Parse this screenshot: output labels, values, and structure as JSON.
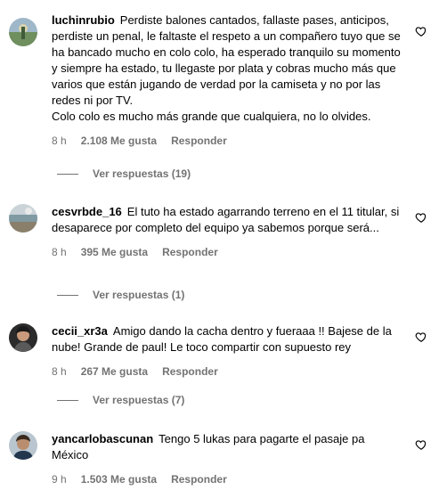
{
  "comments": [
    {
      "username": "luchinrubio",
      "text": "Perdiste balones cantados, fallaste pases, anticipos, perdiste un penal, le faltaste el respeto a un compañero tuyo que se ha bancado mucho en colo colo, ha esperado tranquilo su momento y siempre ha estado, tu llegaste por plata y cobras mucho más que varios que están jugando de verdad por la camiseta y no por las redes ni por TV.\nColo colo es mucho más grande que cualquiera, no lo olvides.",
      "time": "8 h",
      "likes": "2.108 Me gusta",
      "reply": "Responder",
      "view_replies": "Ver respuestas (19)",
      "avatar_icon": "profile-photo-landscape"
    },
    {
      "username": "cesvrbde_16",
      "text": "El tuto ha estado agarrando terreno en el 11 titular, si desaparece por completo del equipo ya sabemos porque será...",
      "time": "8 h",
      "likes": "395 Me gusta",
      "reply": "Responder",
      "view_replies": "Ver respuestas (1)",
      "avatar_icon": "profile-photo-coast"
    },
    {
      "username": "cecii_xr3a",
      "text": "Amigo dando la cacha dentro y fueraaa !! Bajese de la nube! Grande de paul! Le toco compartir con supuesto rey",
      "time": "8 h",
      "likes": "267 Me gusta",
      "reply": "Responder",
      "view_replies": "Ver respuestas (7)",
      "avatar_icon": "profile-photo-person"
    },
    {
      "username": "yancarlobascunan",
      "text": "Tengo 5 lukas para pagarte el pasaje pa México",
      "time": "9 h",
      "likes": "1.503 Me gusta",
      "reply": "Responder",
      "avatar_icon": "profile-photo-selfie"
    }
  ],
  "colors": {
    "text": "#000000",
    "secondary": "#737373"
  }
}
